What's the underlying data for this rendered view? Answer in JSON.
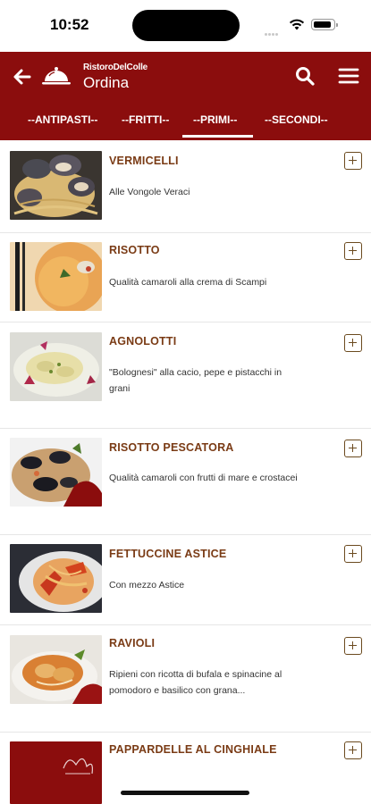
{
  "status_bar": {
    "time": "10:52"
  },
  "header": {
    "brand": "RistoroDelColle",
    "title": "Ordina"
  },
  "tabs": [
    {
      "label": "--ANTIPASTI--",
      "selected": false
    },
    {
      "label": "--FRITTI--",
      "selected": false
    },
    {
      "label": "--PRIMI--",
      "selected": true
    },
    {
      "label": "--SECONDI--",
      "selected": false
    }
  ],
  "menu_items": [
    {
      "name": "VERMICELLI",
      "description": "Alle Vongole Veraci"
    },
    {
      "name": "RISOTTO",
      "description": "Qualità camaroli alla crema di Scampi"
    },
    {
      "name": "AGNOLOTTI",
      "description": "\"Bolognesi\" alla cacio, pepe e pistacchi in grani"
    },
    {
      "name": "RISOTTO PESCATORA",
      "description": "Qualità camaroli con frutti di mare e crostacei"
    },
    {
      "name": "FETTUCCINE ASTICE",
      "description": "Con mezzo Astice"
    },
    {
      "name": "RAVIOLI",
      "description": "Ripieni con ricotta di bufala e spinacine al pomodoro e basilico con grana..."
    },
    {
      "name": "PAPPARDELLE AL CINGHIALE",
      "description": ""
    }
  ],
  "colors": {
    "header_bg": "#8b0d0d",
    "dish_name": "#7a3b15",
    "add_icon": "#6b4a1f"
  },
  "icons": {
    "back": "arrow-left-icon",
    "logo": "cloche-icon",
    "search": "search-icon",
    "menu": "hamburger-icon",
    "add": "plus-square-icon"
  }
}
